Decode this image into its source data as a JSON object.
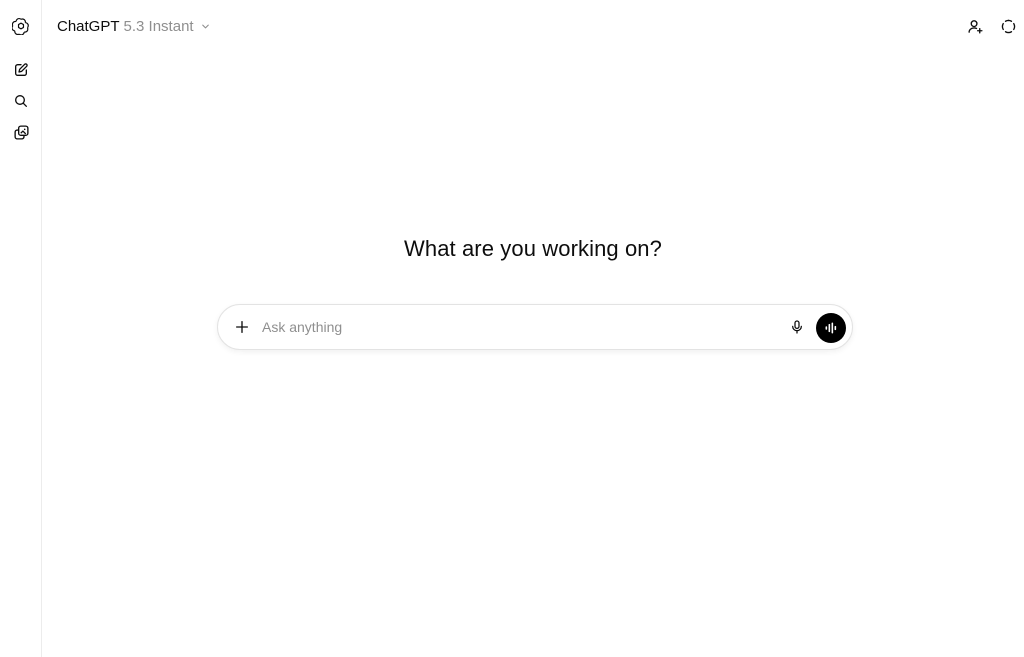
{
  "header": {
    "model_name": "ChatGPT",
    "model_version": "5.3 Instant"
  },
  "sidebar": {
    "items": [
      {
        "icon": "openai-logo-icon"
      },
      {
        "icon": "new-chat-icon"
      },
      {
        "icon": "search-icon"
      },
      {
        "icon": "images-icon"
      }
    ]
  },
  "header_actions": [
    {
      "icon": "add-people-icon"
    },
    {
      "icon": "temporary-chat-icon"
    }
  ],
  "main": {
    "greeting": "What are you working on?"
  },
  "composer": {
    "placeholder": "Ask anything",
    "value": ""
  },
  "colors": {
    "text": "#0d0d0d",
    "muted": "#8f8f8f",
    "voice_button": "#000000",
    "border": "#e3e3e3"
  }
}
